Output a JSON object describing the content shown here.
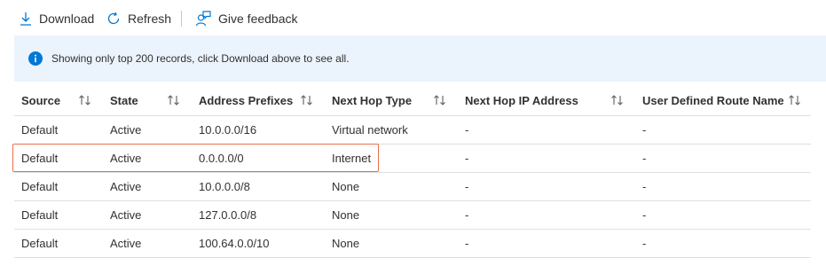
{
  "toolbar": {
    "download_label": "Download",
    "refresh_label": "Refresh",
    "feedback_label": "Give feedback",
    "icon_color": "#0078d4"
  },
  "banner": {
    "message": "Showing only top 200 records, click Download above to see all.",
    "icon": "info-icon",
    "background": "#ebf3fc"
  },
  "table": {
    "columns": [
      {
        "label": "Source"
      },
      {
        "label": "State"
      },
      {
        "label": "Address Prefixes"
      },
      {
        "label": "Next Hop Type"
      },
      {
        "label": "Next Hop IP Address"
      },
      {
        "label": "User Defined Route Name"
      }
    ],
    "rows": [
      {
        "source": "Default",
        "state": "Active",
        "prefix": "10.0.0.0/16",
        "hop_type": "Virtual network",
        "hop_ip": "-",
        "udr": "-"
      },
      {
        "source": "Default",
        "state": "Active",
        "prefix": "0.0.0.0/0",
        "hop_type": "Internet",
        "hop_ip": "-",
        "udr": "-"
      },
      {
        "source": "Default",
        "state": "Active",
        "prefix": "10.0.0.0/8",
        "hop_type": "None",
        "hop_ip": "-",
        "udr": "-"
      },
      {
        "source": "Default",
        "state": "Active",
        "prefix": "127.0.0.0/8",
        "hop_type": "None",
        "hop_ip": "-",
        "udr": "-"
      },
      {
        "source": "Default",
        "state": "Active",
        "prefix": "100.64.0.0/10",
        "hop_type": "None",
        "hop_ip": "-",
        "udr": "-"
      }
    ],
    "highlight_color": "#e8704a"
  }
}
